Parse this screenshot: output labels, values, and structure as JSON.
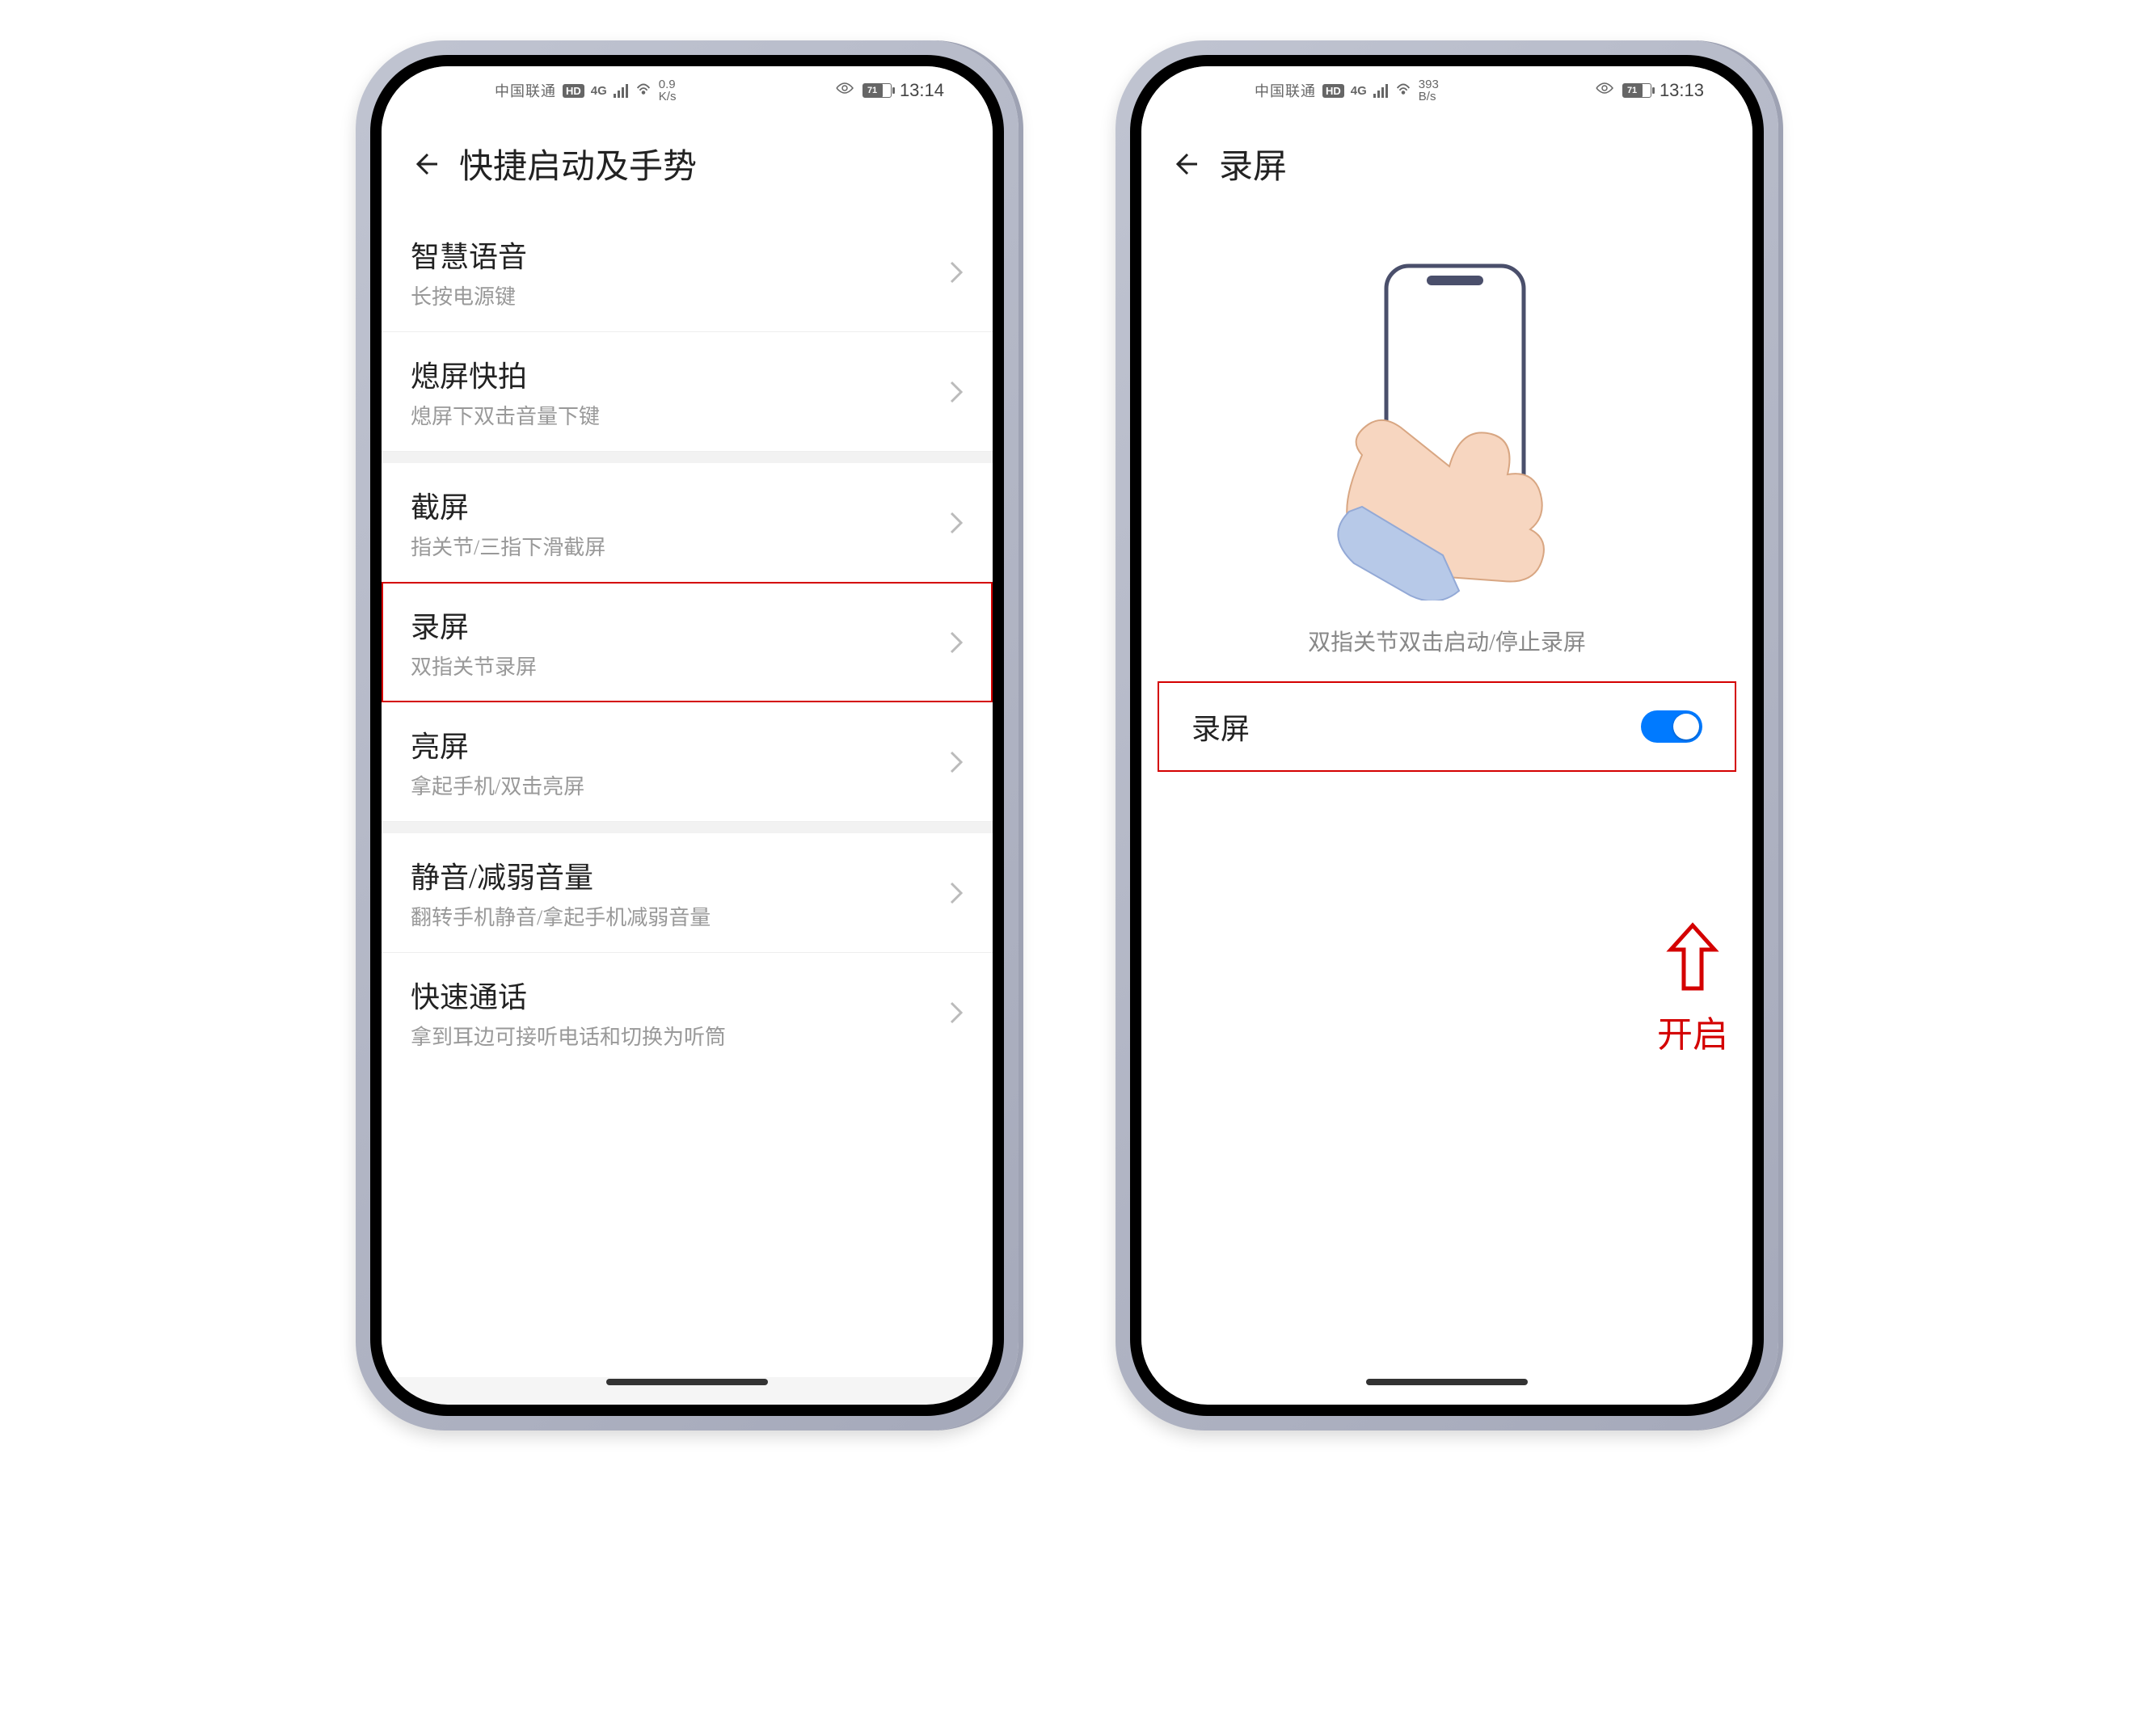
{
  "phone1": {
    "status": {
      "carrier": "中国联通",
      "hd": "HD",
      "net4g": "4G",
      "speed_top": "0.9",
      "speed_bot": "K/s",
      "battery_pct": "71",
      "time": "13:14"
    },
    "title": "快捷启动及手势",
    "groups": [
      [
        {
          "title": "智慧语音",
          "sub": "长按电源键"
        },
        {
          "title": "熄屏快拍",
          "sub": "熄屏下双击音量下键"
        }
      ],
      [
        {
          "title": "截屏",
          "sub": "指关节/三指下滑截屏"
        },
        {
          "title": "录屏",
          "sub": "双指关节录屏",
          "highlighted": true
        },
        {
          "title": "亮屏",
          "sub": "拿起手机/双击亮屏"
        }
      ],
      [
        {
          "title": "静音/减弱音量",
          "sub": "翻转手机静音/拿起手机减弱音量"
        },
        {
          "title": "快速通话",
          "sub": "拿到耳边可接听电话和切换为听筒"
        }
      ]
    ]
  },
  "phone2": {
    "status": {
      "carrier": "中国联通",
      "hd": "HD",
      "net4g": "4G",
      "speed_top": "393",
      "speed_bot": "B/s",
      "battery_pct": "71",
      "time": "13:13"
    },
    "title": "录屏",
    "caption": "双指关节双击启动/停止录屏",
    "toggle_label": "录屏",
    "toggle_on": true,
    "annotation": "开启"
  }
}
